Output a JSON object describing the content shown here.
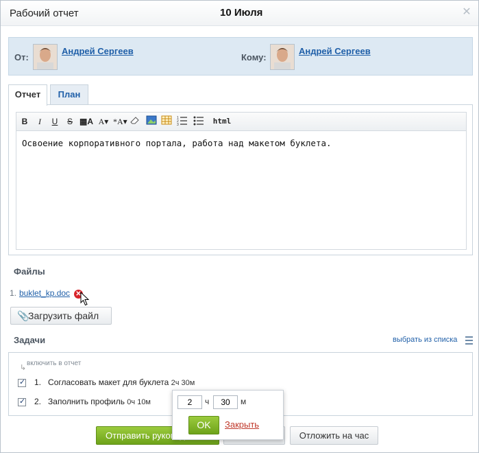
{
  "header": {
    "title": "Рабочий отчет",
    "date": "10 Июля"
  },
  "people": {
    "from_label": "От:",
    "from_name": "Андрей Сергеев",
    "to_label": "Кому:",
    "to_name": "Андрей Сергеев"
  },
  "tabs": [
    {
      "label": "Отчет",
      "active": true
    },
    {
      "label": "План",
      "active": false
    }
  ],
  "toolbar": {
    "items": [
      "bold-icon",
      "italic-icon",
      "underline-icon",
      "strikethrough-icon",
      "color-icon",
      "font-size-icon",
      "font-style-icon",
      "eraser-icon",
      "image-icon",
      "table-icon",
      "numbered-list-icon",
      "bulleted-list-icon"
    ],
    "html_label": "html"
  },
  "editor": {
    "text": "Освоение корпоративного портала, работа над макетом буклета."
  },
  "files": {
    "title": "Файлы",
    "items": [
      {
        "num": "1.",
        "name": "buklet_kp.doc"
      }
    ],
    "upload_label": "Загрузить файл"
  },
  "tasks": {
    "title": "Задачи",
    "pick_label": "выбрать из списка",
    "include_hint": "включить в отчет",
    "items": [
      {
        "num": "1.",
        "text": "Согласовать макет для буклета",
        "time": "2ч 30м",
        "checked": true
      },
      {
        "num": "2.",
        "text": "Заполнить профиль",
        "time": "0ч 10м",
        "checked": true
      }
    ]
  },
  "time_popup": {
    "hours": "2",
    "hours_unit": "ч",
    "minutes": "30",
    "minutes_unit": "м",
    "ok_label": "OK",
    "close_label": "Закрыть"
  },
  "footer": {
    "send_label": "Отправить руководителю",
    "postpone_label": "Отложить на час"
  },
  "colors": {
    "link": "#1f5fa8",
    "accent_green": "#7bb021",
    "close_red": "#c0392b"
  }
}
